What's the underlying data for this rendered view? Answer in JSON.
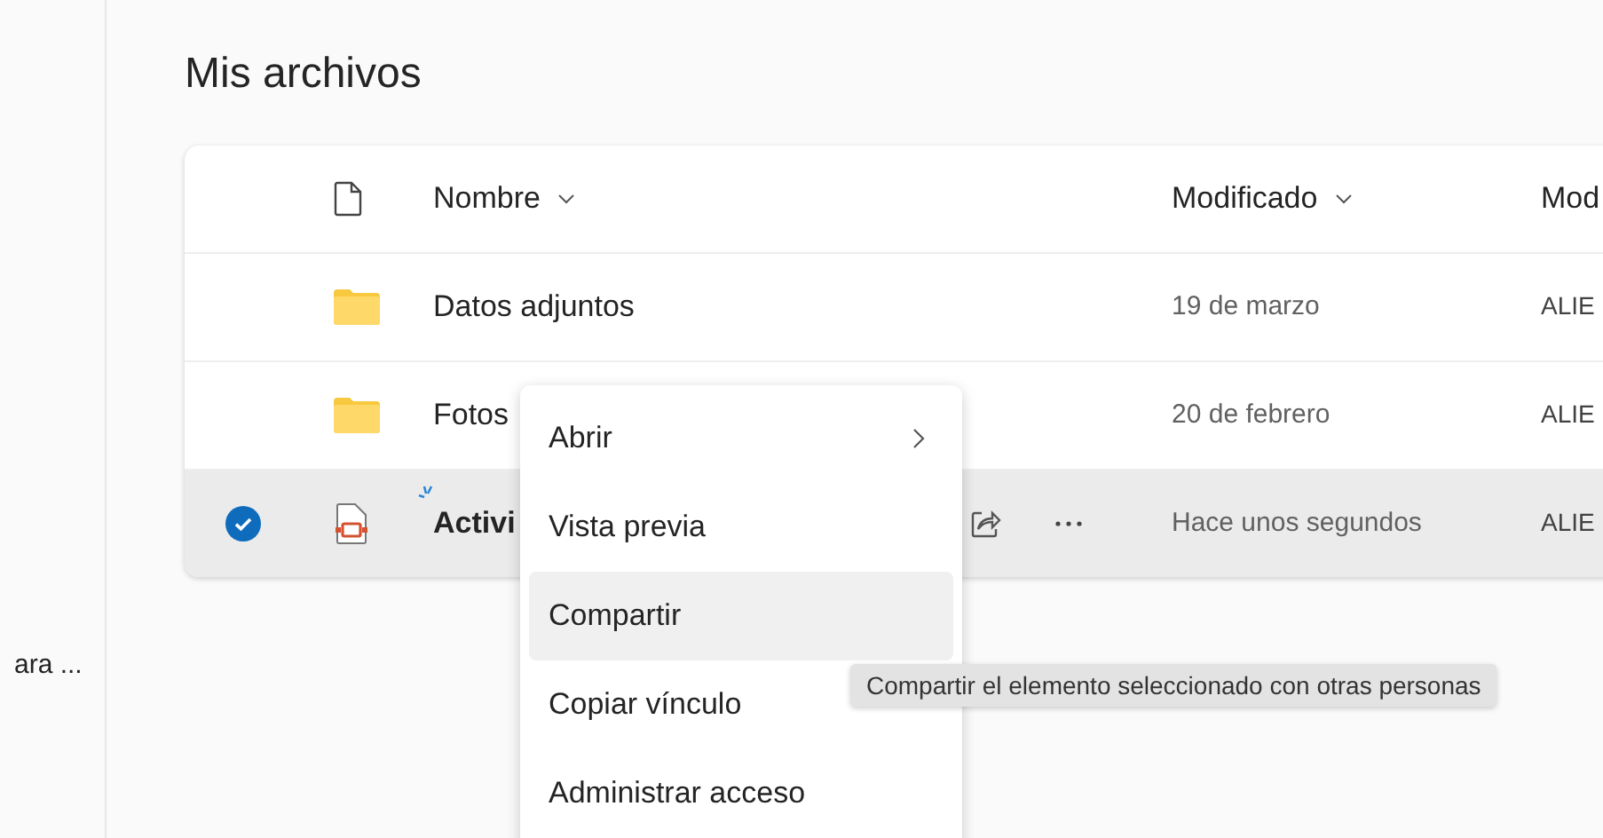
{
  "sidebar": {
    "item_text": "ara ..."
  },
  "title": "Mis archivos",
  "table": {
    "columns": [
      {
        "label": "Nombre",
        "sortable": true
      },
      {
        "label": "Modificado",
        "sortable": true
      },
      {
        "label": "Mod",
        "sortable": false
      }
    ],
    "rows": [
      {
        "kind": "folder",
        "name": "Datos adjuntos",
        "modified": "19 de marzo",
        "modified_by": "ALIE",
        "selected": false,
        "recent": false
      },
      {
        "kind": "folder",
        "name": "Fotos",
        "modified": "20 de febrero",
        "modified_by": "ALIE",
        "selected": false,
        "recent": false
      },
      {
        "kind": "presentation",
        "name": "Activi",
        "modified": "Hace unos segundos",
        "modified_by": "ALIE",
        "selected": true,
        "recent": true
      }
    ]
  },
  "context_menu": {
    "items": [
      {
        "label": "Abrir",
        "submenu": true,
        "hovered": false
      },
      {
        "label": "Vista previa",
        "submenu": false,
        "hovered": false
      },
      {
        "label": "Compartir",
        "submenu": false,
        "hovered": true
      },
      {
        "label": "Copiar vínculo",
        "submenu": false,
        "hovered": false
      },
      {
        "label": "Administrar acceso",
        "submenu": false,
        "hovered": false
      }
    ]
  },
  "tooltip": "Compartir el elemento seleccionado con otras personas"
}
